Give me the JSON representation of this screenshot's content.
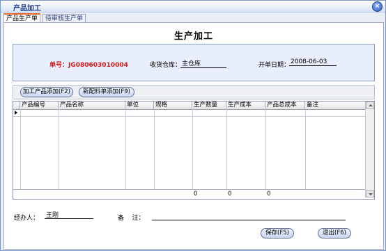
{
  "window": {
    "title": "产品加工"
  },
  "tabs": [
    {
      "label": "产品生产单"
    },
    {
      "label": "待审核生产单"
    }
  ],
  "page_title": "生产加工",
  "info": {
    "order_no": "单号：JG080603010004",
    "warehouse_label": "收货仓库：",
    "warehouse_value": "主仓库",
    "date_label": "开单日期：",
    "date_value": "2008-06-03"
  },
  "buttons": {
    "add_product": "加工产品添加(F2)",
    "add_recipe": "新配料单添加(F9)",
    "save": "保存(F5)",
    "exit": "退出(F6)"
  },
  "grid": {
    "columns": [
      "产品编号",
      "产品名称",
      "单位",
      "规格",
      "生产数量",
      "生产成本",
      "产品总成本",
      "备注"
    ],
    "totals": {
      "quantity": "0",
      "cost": "0",
      "total_cost": "0"
    }
  },
  "footer": {
    "handler_label": "经办人：",
    "handler_value": "王刚",
    "remark_label": "备    注：",
    "remark_value": ""
  }
}
